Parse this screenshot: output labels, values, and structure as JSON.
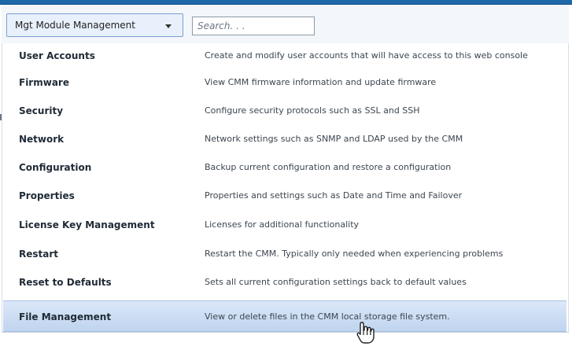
{
  "toolbar": {
    "menu_label": "Mgt Module Management",
    "search_placeholder": "Search. . ."
  },
  "menu": {
    "items": [
      {
        "title": "User Accounts",
        "description": "Create and modify user accounts that will have access to this web console"
      },
      {
        "title": "Firmware",
        "description": "View CMM firmware information and update firmware"
      },
      {
        "title": "Security",
        "description": "Configure security protocols such as SSL and SSH"
      },
      {
        "title": "Network",
        "description": "Network settings such as SNMP and LDAP used by the CMM"
      },
      {
        "title": "Configuration",
        "description": "Backup current configuration and restore a configuration"
      },
      {
        "title": "Properties",
        "description": "Properties and settings such as Date and Time and Failover"
      },
      {
        "title": "License Key Management",
        "description": "Licenses for additional functionality"
      },
      {
        "title": "Restart",
        "description": "Restart the CMM. Typically only needed when experiencing problems"
      },
      {
        "title": "Reset to Defaults",
        "description": "Sets all current configuration settings back to default values"
      },
      {
        "title": "File Management",
        "description": "View or delete files in the CMM local storage file system."
      }
    ]
  },
  "icons": {
    "dropdown_caret": "chevron-down-icon",
    "pointer": "hand-pointer-icon"
  },
  "colors": {
    "accent": "#1e67a8",
    "highlight": "#bfd4ef"
  }
}
